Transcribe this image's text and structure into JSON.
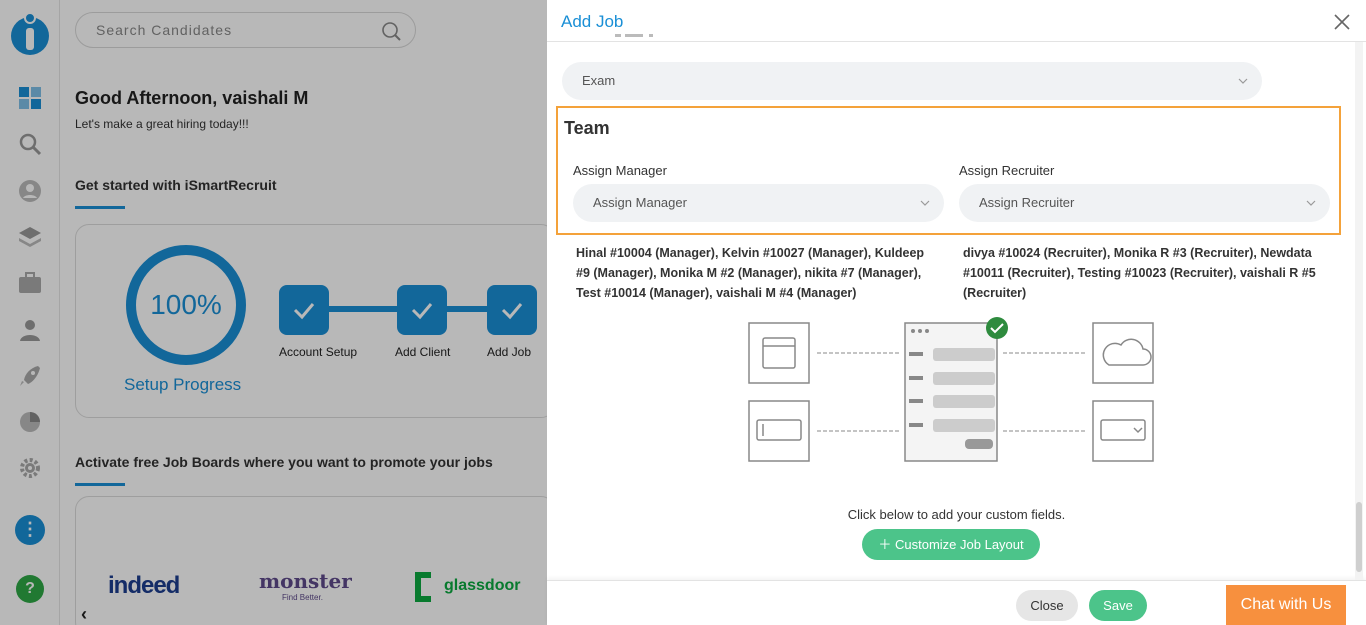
{
  "search": {
    "placeholder": "Search Candidates"
  },
  "dashboard": {
    "greeting": "Good Afternoon,  vaishali M",
    "subtitle": "Let's make a great hiring today!!!",
    "get_started_title": "Get started with iSmartRecruit",
    "progress_value": "100%",
    "progress_label": "Setup Progress",
    "steps": [
      "Account Setup",
      "Add Client",
      "Add Job"
    ],
    "job_boards_title": "Activate free Job Boards where you want to promote your jobs",
    "boards": [
      "indeed",
      "monster",
      "Find Better.",
      "glassdoor"
    ]
  },
  "rail": {
    "more_label": "⋮",
    "help_label": "?"
  },
  "modal": {
    "title": "Add Job",
    "exam_select": "Exam",
    "team": {
      "title": "Team",
      "manager_label": "Assign Manager",
      "manager_placeholder": "Assign Manager",
      "recruiter_label": "Assign Recruiter",
      "recruiter_placeholder": "Assign Recruiter",
      "managers_text": "Hinal #10004 (Manager), Kelvin #10027 (Manager), Kuldeep #9 (Manager), Monika M #2 (Manager), nikita #7 (Manager), Test #10014 (Manager), vaishali M #4 (Manager)",
      "recruiters_text": "divya #10024 (Recruiter), Monika R #3 (Recruiter), Newdata #10011 (Recruiter), Testing #10023 (Recruiter), vaishali R #5 (Recruiter)"
    },
    "custom_fields_text": "Click below to add your custom fields.",
    "customize_button": "Customize Job Layout",
    "close_button": "Close",
    "save_button": "Save"
  },
  "chat_button": "Chat with Us",
  "colors": {
    "primary": "#1a8fd6",
    "success": "#4cc48a",
    "highlight": "#f4a23a",
    "chat": "#f7903e"
  }
}
